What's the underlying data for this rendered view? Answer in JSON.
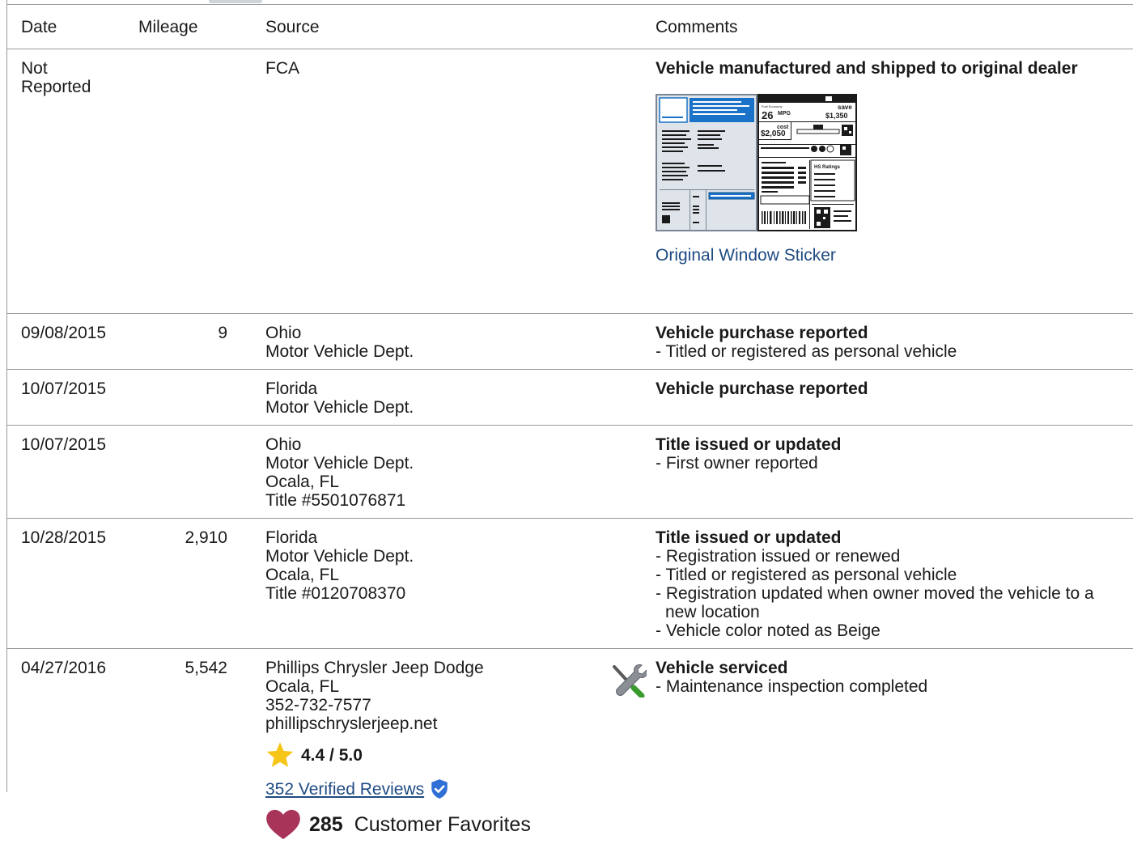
{
  "headers": {
    "date": "Date",
    "mileage": "Mileage",
    "source": "Source",
    "comments": "Comments"
  },
  "rows": [
    {
      "date": "Not Reported",
      "mileage": "",
      "source": [
        "FCA"
      ],
      "comment_title": "Vehicle manufactured and shipped to original dealer",
      "comment_items": [],
      "sticker": {
        "mpg": "26",
        "mpg_unit": "MPG",
        "save": "save",
        "save_amount": "$1,350",
        "annual_cost_label": "cost",
        "annual_cost": "$2,050",
        "ratings_label": "HS Ratings",
        "link_label": "Original Window Sticker"
      }
    },
    {
      "date": "09/08/2015",
      "mileage": "9",
      "source": [
        "Ohio",
        "Motor Vehicle Dept."
      ],
      "comment_title": "Vehicle purchase reported",
      "comment_items": [
        "- Titled or registered as personal vehicle"
      ]
    },
    {
      "date": "10/07/2015",
      "mileage": "",
      "source": [
        "Florida",
        "Motor Vehicle Dept."
      ],
      "comment_title": "Vehicle purchase reported",
      "comment_items": []
    },
    {
      "date": "10/07/2015",
      "mileage": "",
      "source": [
        "Ohio",
        "Motor Vehicle Dept.",
        "Ocala, FL",
        "Title #5501076871"
      ],
      "comment_title": "Title issued or updated",
      "comment_items": [
        "- First owner reported"
      ]
    },
    {
      "date": "10/28/2015",
      "mileage": "2,910",
      "source": [
        "Florida",
        "Motor Vehicle Dept.",
        "Ocala, FL",
        "Title #0120708370"
      ],
      "comment_title": "Title issued or updated",
      "comment_items": [
        "- Registration issued or renewed",
        "- Titled or registered as personal vehicle",
        "- Registration updated when owner moved the vehicle to a new location",
        "- Vehicle color noted as Beige"
      ]
    },
    {
      "date": "04/27/2016",
      "mileage": "5,542",
      "source": [
        "Phillips Chrysler Jeep Dodge",
        "Ocala, FL",
        "352-732-7577",
        "phillipschryslerjeep.net"
      ],
      "rating": "4.4 / 5.0",
      "reviews_link": "352 Verified Reviews",
      "favorites_count": "285",
      "favorites_label": "Customer Favorites",
      "comment_title": "Vehicle serviced",
      "comment_items": [
        "- Maintenance inspection completed"
      ],
      "icon": "wrench-screwdriver-icon"
    }
  ],
  "colors": {
    "link": "#1e4b82",
    "border": "#9a9a9a",
    "star": "#f5c518",
    "heart": "#a8345a",
    "verified": "#2f6fd6",
    "sticker_blue": "#1a73c8"
  }
}
